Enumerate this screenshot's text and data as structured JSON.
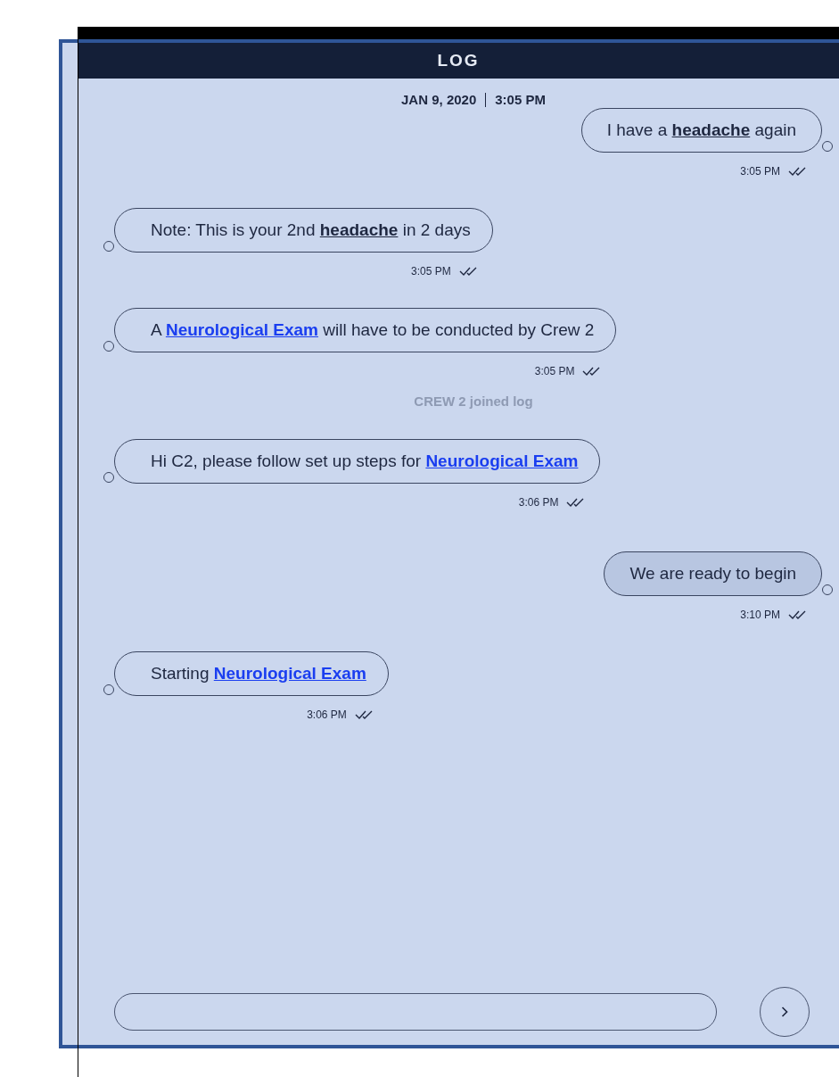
{
  "header": {
    "title": "LOG"
  },
  "date_line": {
    "date": "JAN 9, 2020",
    "time": "3:05 PM"
  },
  "items": [
    {
      "kind": "message",
      "outgoing": true,
      "highlighted": false,
      "time": "3:05 PM",
      "read": true,
      "parts": [
        {
          "kind": "plain",
          "text": "I have a "
        },
        {
          "kind": "term",
          "text": "headache"
        },
        {
          "kind": "plain",
          "text": " again"
        }
      ]
    },
    {
      "kind": "message",
      "outgoing": false,
      "highlighted": false,
      "time": "3:05 PM",
      "read": true,
      "parts": [
        {
          "kind": "plain",
          "text": "Note: This is your 2nd "
        },
        {
          "kind": "term",
          "text": "headache"
        },
        {
          "kind": "plain",
          "text": " in 2 days"
        }
      ]
    },
    {
      "kind": "message",
      "outgoing": false,
      "highlighted": false,
      "time": "3:05 PM",
      "read": true,
      "parts": [
        {
          "kind": "plain",
          "text": "A "
        },
        {
          "kind": "link",
          "text": "Neurological Exam"
        },
        {
          "kind": "plain",
          "text": " will have to be conducted by Crew 2"
        }
      ]
    },
    {
      "kind": "event",
      "text": "CREW 2 joined log"
    },
    {
      "kind": "message",
      "outgoing": false,
      "highlighted": false,
      "time": "3:06 PM",
      "read": true,
      "parts": [
        {
          "kind": "plain",
          "text": "Hi C2, please follow set up steps for "
        },
        {
          "kind": "link",
          "text": "Neurological Exam"
        }
      ]
    },
    {
      "kind": "message",
      "outgoing": true,
      "highlighted": true,
      "time": "3:10 PM",
      "read": true,
      "parts": [
        {
          "kind": "plain",
          "text": "We are ready to begin"
        }
      ]
    },
    {
      "kind": "message",
      "outgoing": false,
      "highlighted": false,
      "time": "3:06 PM",
      "read": true,
      "parts": [
        {
          "kind": "plain",
          "text": "Starting "
        },
        {
          "kind": "link",
          "text": "Neurological Exam"
        }
      ]
    }
  ]
}
